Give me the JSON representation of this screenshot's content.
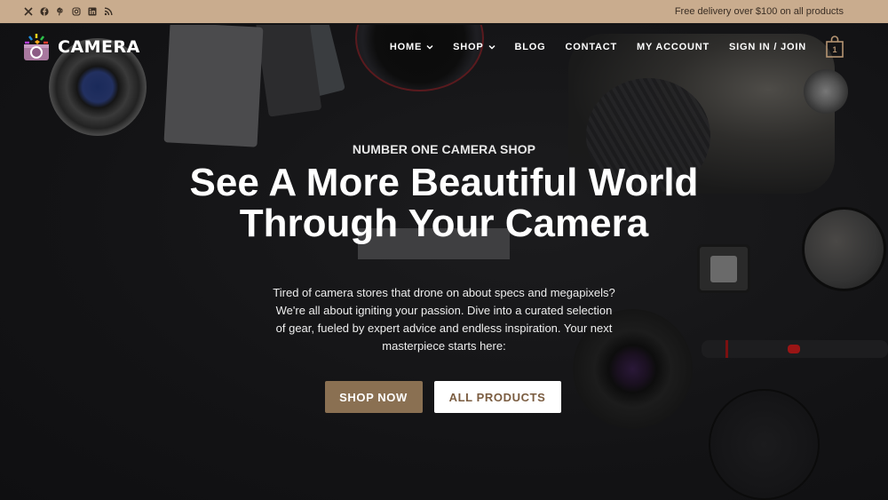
{
  "topbar": {
    "social_icons": [
      "x-icon",
      "facebook-icon",
      "pinterest-icon",
      "instagram-icon",
      "linkedin-icon",
      "rss-icon"
    ],
    "promo_text": "Free delivery over $100 on all products"
  },
  "header": {
    "logo_text": "CAMERA",
    "menu": [
      {
        "label": "HOME",
        "has_dropdown": true
      },
      {
        "label": "SHOP",
        "has_dropdown": true
      },
      {
        "label": "BLOG",
        "has_dropdown": false
      },
      {
        "label": "CONTACT",
        "has_dropdown": false
      },
      {
        "label": "MY ACCOUNT",
        "has_dropdown": false
      },
      {
        "label": "SIGN IN / JOIN",
        "has_dropdown": false
      }
    ],
    "cart_count": "1"
  },
  "hero": {
    "eyebrow": "NUMBER ONE CAMERA SHOP",
    "headline_line1": "See A More Beautiful World",
    "headline_line2": "Through Your Camera",
    "description_lines": [
      "Tired of camera stores that drone on about specs and megapixels?",
      "We're all about igniting your passion. Dive into a curated selection",
      "of gear, fueled by expert advice and endless inspiration. Your next",
      "masterpiece starts here:"
    ],
    "primary_button": "SHOP NOW",
    "secondary_button": "ALL PRODUCTS"
  },
  "colors": {
    "topbar_bg": "#c9ac8e",
    "accent": "#8a7052",
    "hero_bg": "#131315",
    "secondary_button_text": "#7a5c40"
  }
}
